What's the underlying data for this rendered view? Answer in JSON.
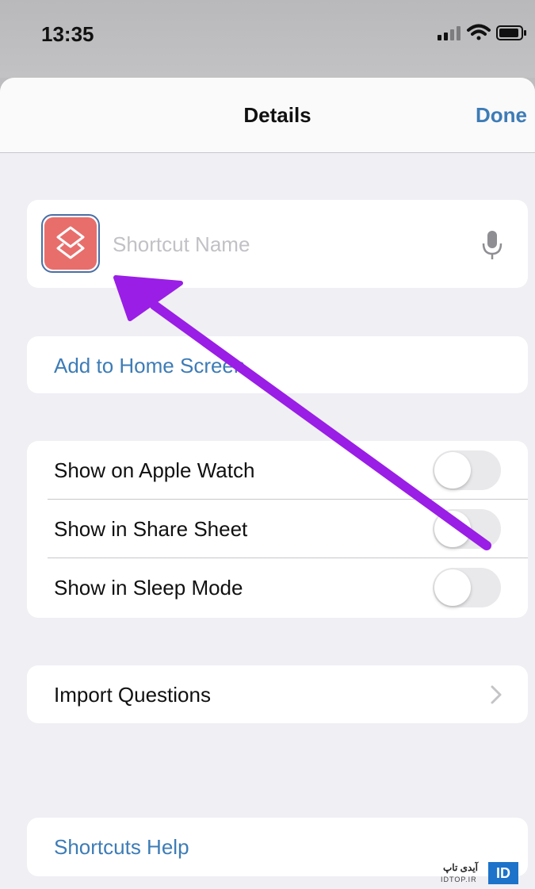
{
  "status_bar": {
    "time": "13:35"
  },
  "navbar": {
    "title": "Details",
    "done_label": "Done"
  },
  "name_card": {
    "placeholder": "Shortcut Name",
    "icon": "shortcuts-layers-icon"
  },
  "add_home": {
    "label": "Add to Home Screen"
  },
  "toggles": [
    {
      "label": "Show on Apple Watch",
      "on": false
    },
    {
      "label": "Show in Share Sheet",
      "on": false
    },
    {
      "label": "Show in Sleep Mode",
      "on": false
    }
  ],
  "import": {
    "label": "Import Questions"
  },
  "help": {
    "label": "Shortcuts Help"
  },
  "watermark": {
    "text": "آیدی تاپ",
    "sub": "IDTOP.IR",
    "badge": "ID"
  },
  "colors": {
    "accent": "#3d7cb6",
    "icon_tile": "#e86e6b",
    "arrow": "#9a1ee6"
  }
}
